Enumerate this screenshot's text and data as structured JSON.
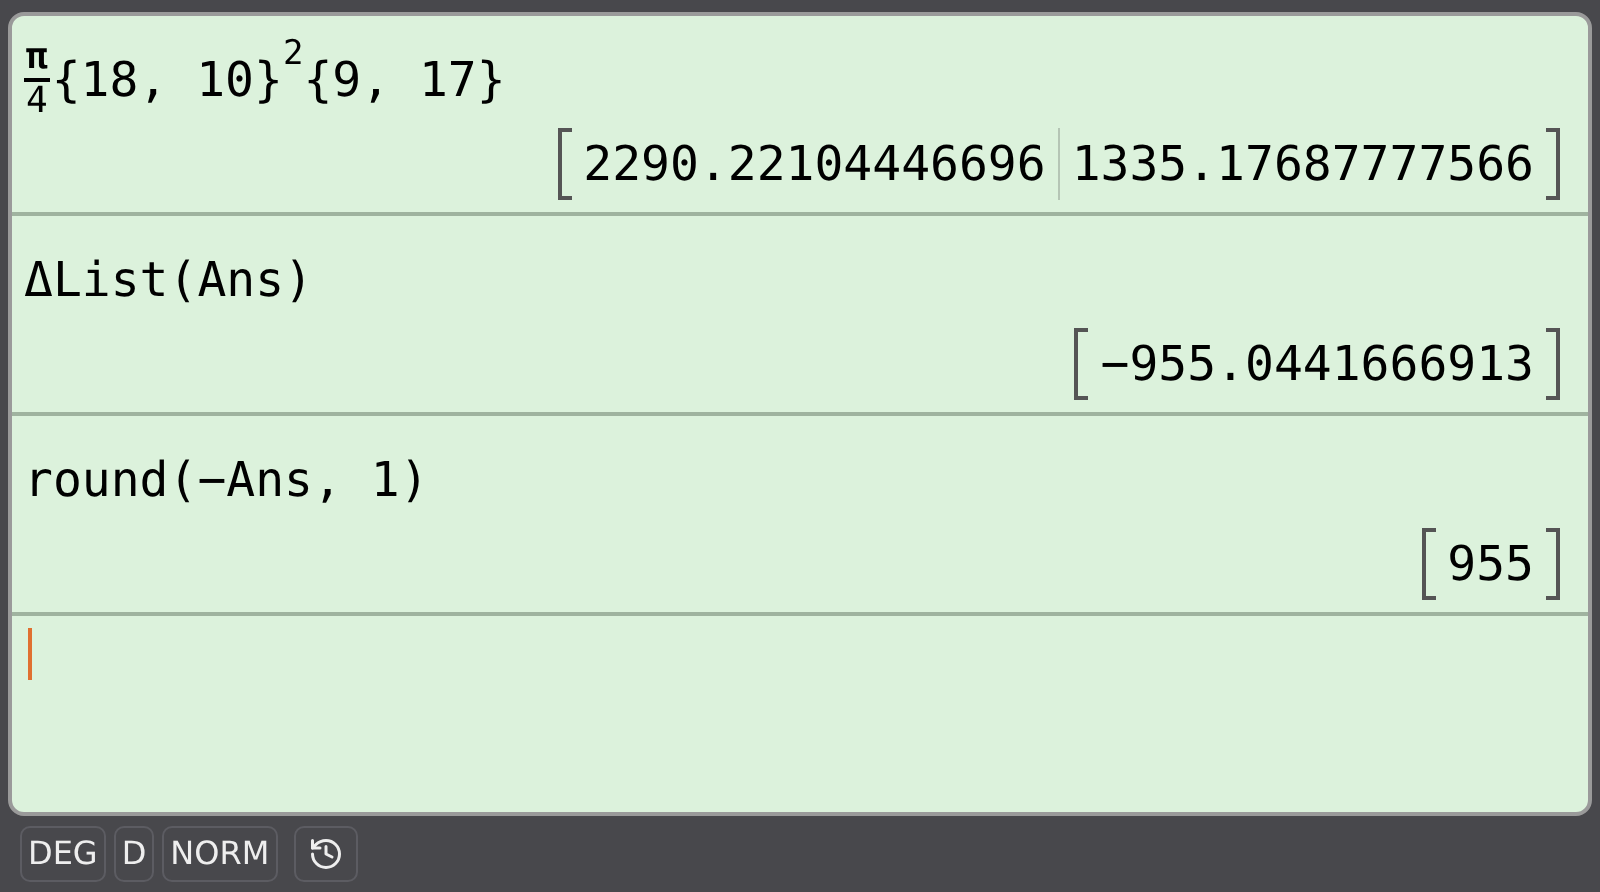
{
  "history": [
    {
      "input": [
        {
          "kind": "fraction",
          "numerator": "π",
          "denominator": "4"
        },
        {
          "kind": "text",
          "text": "{18, 10}"
        },
        {
          "kind": "sup",
          "text": "2"
        },
        {
          "kind": "text",
          "text": "{9, 17}"
        }
      ],
      "result": [
        "2290.22104446696",
        "1335.17687777566"
      ]
    },
    {
      "input": [
        {
          "kind": "text",
          "text": "ΔList(Ans)"
        }
      ],
      "result": [
        "−955.0441666913"
      ]
    },
    {
      "input": [
        {
          "kind": "text",
          "text": "round(−Ans, 1)"
        }
      ],
      "result": [
        "955"
      ]
    }
  ],
  "status_bar": [
    {
      "kind": "text",
      "label": "DEG"
    },
    {
      "kind": "text",
      "label": "D"
    },
    {
      "kind": "text",
      "label": "NORM"
    },
    {
      "kind": "history"
    }
  ]
}
